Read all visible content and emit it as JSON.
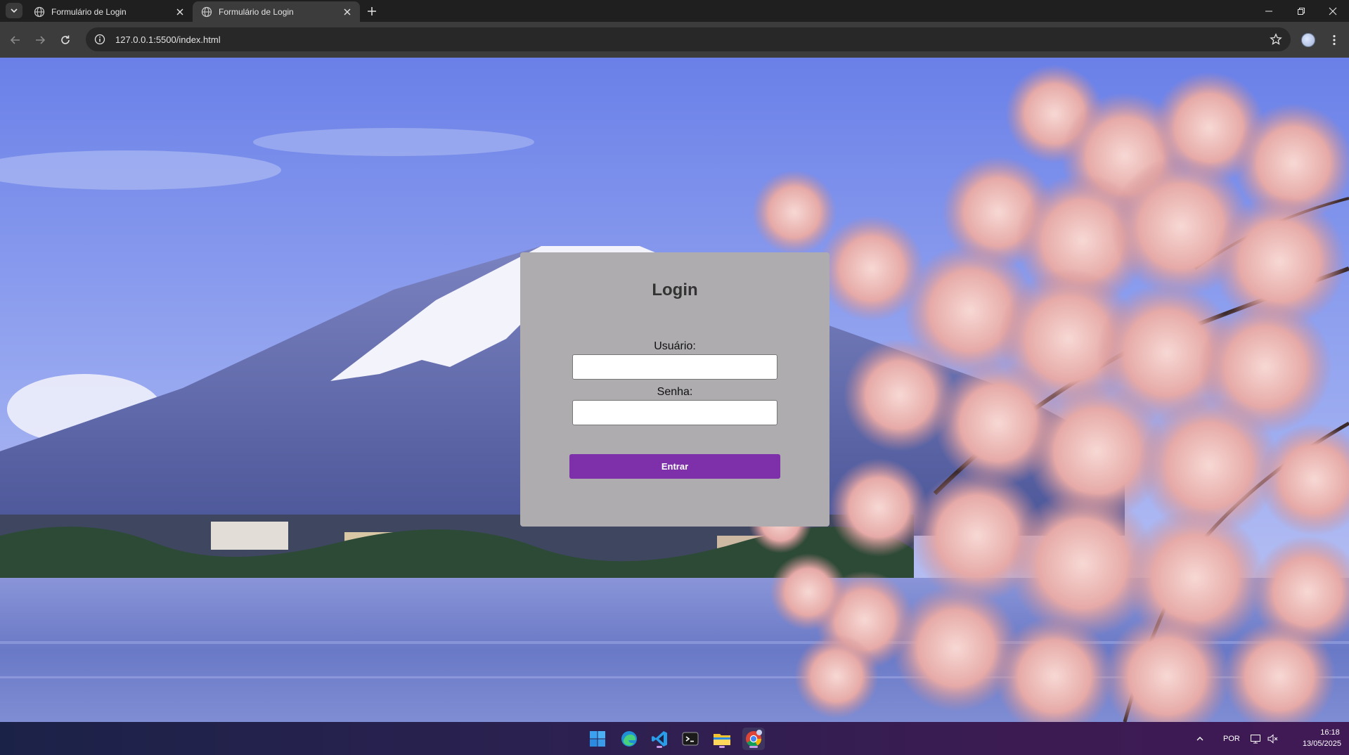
{
  "browser": {
    "tabs": [
      {
        "title": "Formulário de Login",
        "active": false
      },
      {
        "title": "Formulário de Login",
        "active": true
      }
    ],
    "url": "127.0.0.1:5500/index.html"
  },
  "page": {
    "title": "Login",
    "username_label": "Usuário:",
    "password_label": "Senha:",
    "username_value": "",
    "password_value": "",
    "submit_label": "Entrar",
    "colors": {
      "card": "#aeacaf",
      "button": "#7d30a9",
      "button_text": "#ffffff"
    },
    "background": "Mount Fuji with cherry blossoms and lake"
  },
  "taskbar": {
    "apps": [
      "windows-start",
      "edge",
      "vscode",
      "terminal",
      "file-explorer",
      "chrome"
    ],
    "language": "POR",
    "time": "16:18",
    "date": "13/05/2025"
  }
}
